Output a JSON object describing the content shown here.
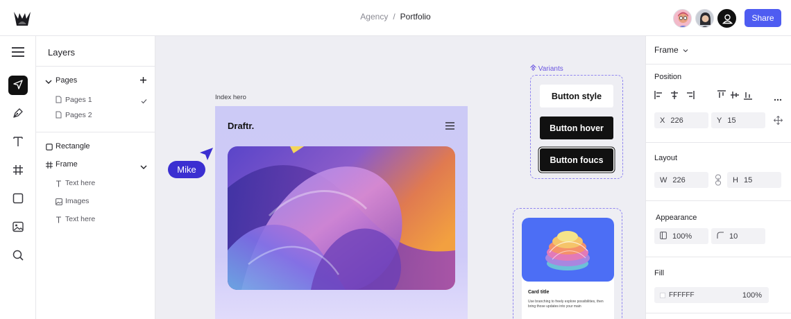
{
  "breadcrumb": {
    "parent": "Agency",
    "separator": "/",
    "current": "Portfolio"
  },
  "share_label": "Share",
  "layers": {
    "title": "Layers",
    "pages_label": "Pages",
    "pages": [
      "Pages 1",
      "Pages 2"
    ],
    "items": {
      "rectangle": "Rectangle",
      "frame": "Frame",
      "children": [
        "Text here",
        "Images",
        "Text here"
      ]
    }
  },
  "canvas": {
    "frame_label": "Index hero",
    "hero_title": "Draftr.",
    "cursor_user": "Mike",
    "variants_label": "Variants",
    "buttons": [
      "Button style",
      "Button hover",
      "Button foucs"
    ],
    "card": {
      "title": "Card title",
      "description": "Use branching to freely explore possibilities, then bring those updates into your main"
    }
  },
  "props": {
    "frame_label": "Frame",
    "position_title": "Position",
    "x_label": "X",
    "x_value": "226",
    "y_label": "Y",
    "y_value": "15",
    "layout_title": "Layout",
    "w_label": "W",
    "w_value": "226",
    "h_label": "H",
    "h_value": "15",
    "appearance_title": "Appearance",
    "opacity": "100%",
    "radius": "10",
    "fill_title": "Fill",
    "fill_hex": "FFFFFF",
    "fill_opacity": "100%"
  },
  "colors": {
    "accent": "#4e5cf1",
    "cursor": "#3b2fd1",
    "variants": "#6a55e0"
  }
}
